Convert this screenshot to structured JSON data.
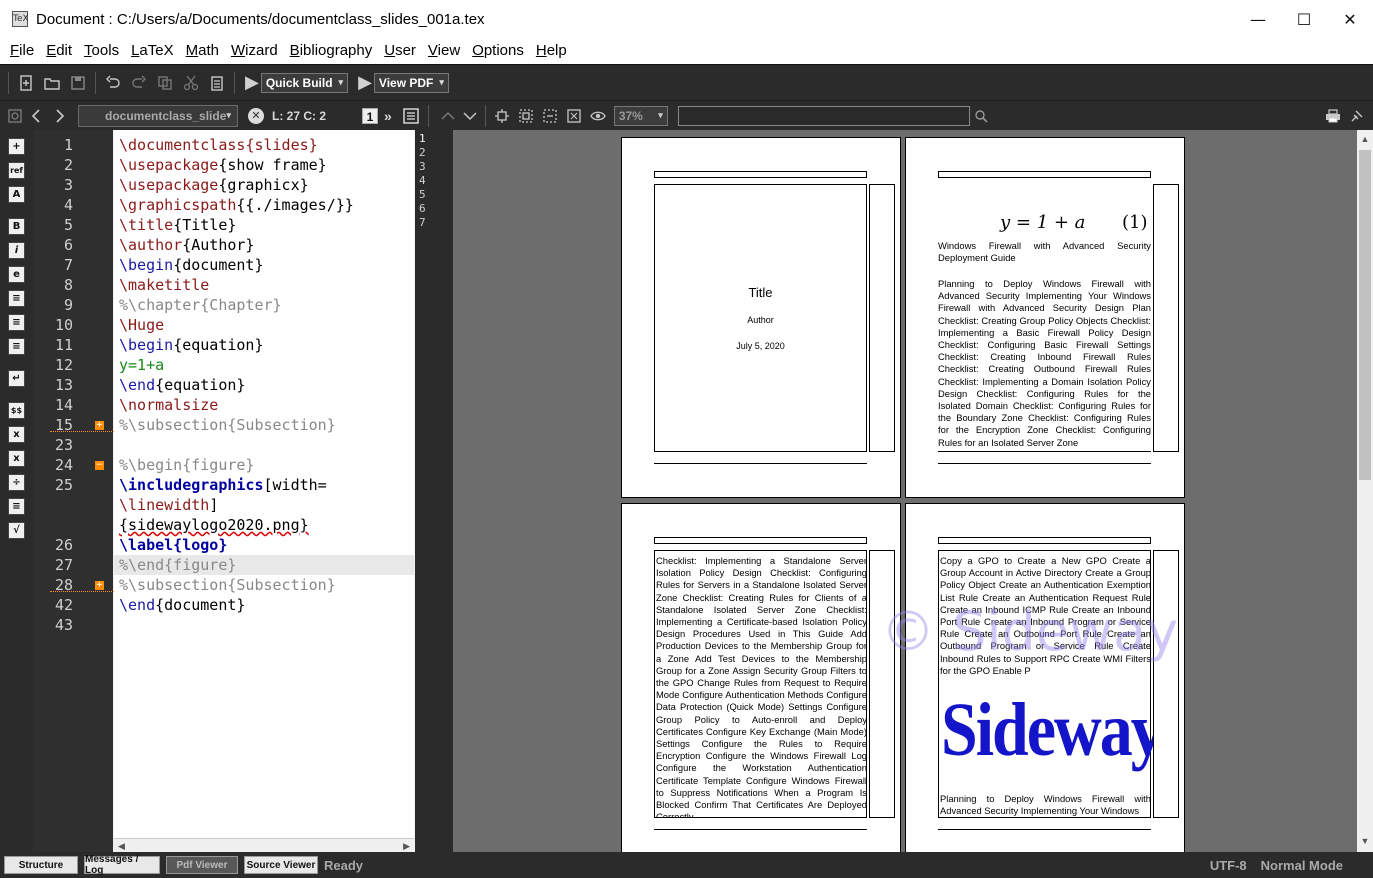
{
  "window": {
    "title": "Document : C:/Users/a/Documents/documentclass_slides_001a.tex",
    "app_icon": "TeX",
    "min_glyph": "—",
    "max_glyph": "☐",
    "close_glyph": "✕"
  },
  "menu": [
    "File",
    "Edit",
    "Tools",
    "LaTeX",
    "Math",
    "Wizard",
    "Bibliography",
    "User",
    "View",
    "Options",
    "Help"
  ],
  "toolbar": {
    "quick_build": "Quick Build",
    "view_pdf": "View PDF",
    "caret": "▾"
  },
  "nav": {
    "file_tab": "documentclass_slide",
    "position": "L: 27 C: 2",
    "more": "»",
    "page_badge": "1",
    "zoom": "37%"
  },
  "side_icons": [
    "+",
    "ref",
    "A",
    "B",
    "i",
    "e",
    "≡",
    "≡",
    "≡",
    "≡",
    "↵",
    "$$",
    "x",
    "x",
    "÷",
    "≡",
    "√"
  ],
  "editor": {
    "line_numbers": [
      "1",
      "2",
      "3",
      "4",
      "5",
      "6",
      "7",
      "8",
      "9",
      "10",
      "11",
      "12",
      "13",
      "14",
      "15",
      "23",
      "24",
      "25",
      "",
      "",
      "26",
      "27",
      "28",
      "42",
      "43"
    ],
    "lines": [
      {
        "parts": [
          [
            "cmd",
            "\\documentclass"
          ],
          [
            "cmd",
            "{slides}"
          ]
        ]
      },
      {
        "parts": [
          [
            "cmd",
            "\\usepackage"
          ],
          [
            "",
            "{show frame}"
          ]
        ]
      },
      {
        "parts": [
          [
            "cmd",
            "\\usepackage"
          ],
          [
            "",
            "{graphicx}"
          ]
        ]
      },
      {
        "parts": [
          [
            "cmd",
            "\\graphicspath"
          ],
          [
            "",
            "{{./images/}}"
          ]
        ]
      },
      {
        "parts": [
          [
            "cmd",
            "\\title"
          ],
          [
            "",
            "{Title}"
          ]
        ]
      },
      {
        "parts": [
          [
            "cmd",
            "\\author"
          ],
          [
            "",
            "{Author}"
          ]
        ]
      },
      {
        "parts": [
          [
            "beg",
            "\\begin"
          ],
          [
            "",
            "{document}"
          ]
        ]
      },
      {
        "parts": [
          [
            "cmd",
            "\\maketitle"
          ]
        ]
      },
      {
        "parts": [
          [
            "cmt",
            "%\\chapter{Chapter}"
          ]
        ]
      },
      {
        "parts": [
          [
            "cmd",
            "\\Huge"
          ]
        ]
      },
      {
        "parts": [
          [
            "beg",
            "\\begin"
          ],
          [
            "",
            "{equation}"
          ]
        ]
      },
      {
        "parts": [
          [
            "math",
            "y=1+a"
          ]
        ]
      },
      {
        "parts": [
          [
            "beg",
            "\\end"
          ],
          [
            "",
            "{equation}"
          ]
        ]
      },
      {
        "parts": [
          [
            "cmd",
            "\\normalsize"
          ]
        ]
      },
      {
        "parts": [
          [
            "cmt",
            "%\\subsection{Subsection}"
          ]
        ]
      },
      {
        "parts": []
      },
      {
        "parts": [
          [
            "cmt",
            "%\\begin{figure}"
          ]
        ]
      },
      {
        "parts": [
          [
            "bold-blue",
            "\\includegraphics"
          ],
          [
            "",
            "[width="
          ]
        ]
      },
      {
        "parts": [
          [
            "cmd",
            "\\linewidth"
          ],
          [
            "",
            "]"
          ]
        ]
      },
      {
        "parts": [
          [
            "",
            "{sidewaylogo2020.png}"
          ]
        ]
      },
      {
        "parts": [
          [
            "bold-blue",
            "\\label{logo}"
          ]
        ]
      },
      {
        "parts": [
          [
            "cmt",
            "%\\end{figure}"
          ]
        ]
      },
      {
        "parts": [
          [
            "cmt",
            "%\\subsection{Subsection}"
          ]
        ]
      },
      {
        "parts": [
          [
            "beg",
            "\\end"
          ],
          [
            "",
            "{document}"
          ]
        ]
      },
      {
        "parts": []
      }
    ]
  },
  "line_panel": [
    "1",
    "2",
    "3",
    "4",
    "5",
    "6",
    "7"
  ],
  "pdf": {
    "page1": {
      "title": "Title",
      "author": "Author",
      "date": "July 5, 2020"
    },
    "page2": {
      "equation": "y = 1 + a",
      "eq_number": "(1)",
      "heading": "Windows Firewall with Advanced Security Deployment Guide",
      "body": "Planning to Deploy Windows Firewall with Advanced Security Implementing Your Windows Firewall with Advanced Security Design Plan Checklist: Creating Group Policy Objects Checklist: Implementing a Basic Firewall Policy Design Checklist: Configuring Basic Firewall Settings Checklist: Creating Inbound Firewall Rules Checklist: Creating Outbound Firewall Rules Checklist: Implementing a Domain Isolation Policy Design Checklist: Configuring Rules for the Isolated Domain Checklist: Configuring Rules for the Boundary Zone Checklist: Configuring Rules for the Encryption Zone Checklist: Configuring Rules for an Isolated Server Zone"
    },
    "page3": {
      "body": "Checklist: Implementing a Standalone Server Isolation Policy Design Checklist: Configuring Rules for Servers in a Standalone Isolated Server Zone Checklist: Creating Rules for Clients of a Standalone Isolated Server Zone Checklist: Implementing a Certificate-based Isolation Policy Design Procedures Used in This Guide Add Production Devices to the Membership Group for a Zone Add Test Devices to the Membership Group for a Zone Assign Security Group Filters to the GPO Change Rules from Request to Require Mode Configure Authentication Methods Configure Data Protection (Quick Mode) Settings Configure Group Policy to Auto-enroll and Deploy Certificates Configure Key Exchange (Main Mode) Settings Configure the Rules to Require Encryption Configure the Windows Firewall Log Configure the Workstation Authentication Certificate Template Configure Windows Firewall to Suppress Notifications When a Program Is Blocked Confirm That Certificates Are Deployed Correctly"
    },
    "page4": {
      "body": "Copy a GPO to Create a New GPO Create a Group Account in Active Directory Create a Group Policy Object Create an Authentication Exemption List Rule Create an Authentication Request Rule Create an Inbound ICMP Rule Create an Inbound Port Rule Create an Inbound Program or Service Rule Create an Outbound Port Rule Create an Outbound Program or Service Rule Create Inbound Rules to Support RPC Create WMI Filters for the GPO Enable P",
      "logo": "Sideway",
      "watermark": "© Sideway",
      "footer": "Planning to Deploy Windows Firewall with Advanced Security Implementing Your Windows"
    }
  },
  "status": {
    "tabs": [
      "Structure",
      "Messages / Log",
      "Pdf Viewer",
      "Source Viewer"
    ],
    "active_tab": "Pdf Viewer",
    "ready": "Ready",
    "encoding": "UTF-8",
    "mode": "Normal Mode"
  }
}
